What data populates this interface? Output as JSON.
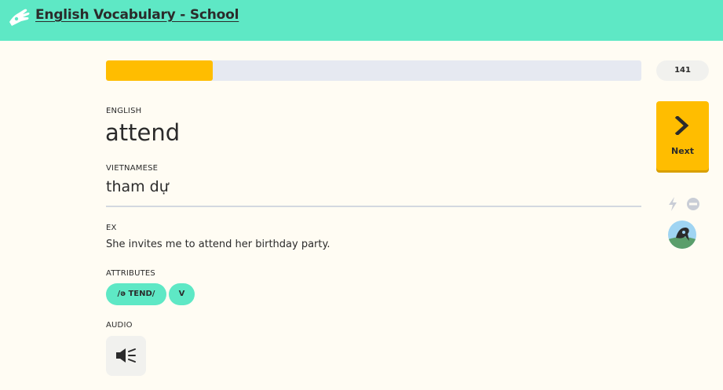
{
  "header": {
    "course_title": "English Vocabulary - School",
    "logo_icon": "memrise-hand-logo-icon"
  },
  "session": {
    "progress": 0.2,
    "count": "141"
  },
  "card": {
    "english_label": "ENGLISH",
    "word": "attend",
    "vietnamese_label": "VIETNAMESE",
    "meaning": "tham dự",
    "ex_label": "EX",
    "example": "She invites me to attend her birthday party.",
    "attributes_label": "ATTRIBUTES",
    "attributes": [
      "/ə TEND/",
      "V"
    ],
    "audio_label": "AUDIO",
    "audio_icon": "speaker-icon"
  },
  "sidebar": {
    "next_label": "Next",
    "next_icon": "chevron-right-icon",
    "bolt_icon": "lightning-bolt-icon",
    "ignore_icon": "minus-circle-icon",
    "avatar_icon": "user-avatar"
  },
  "colors": {
    "header_bg": "#5ee8c5",
    "page_bg": "#fffcf3",
    "accent": "#ffbd00",
    "chip_bg": "#5ee8c5",
    "track": "#e6e9f1"
  }
}
